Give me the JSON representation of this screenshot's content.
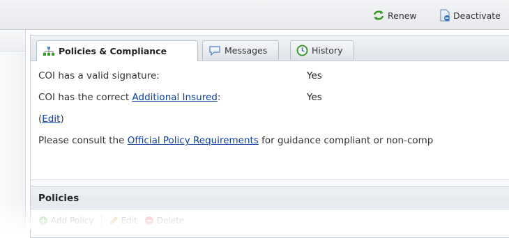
{
  "toolbar": {
    "renew_label": "Renew",
    "deactivate_label": "Deactivate"
  },
  "tabs": [
    {
      "label": "Policies & Compliance",
      "icon": "org-chart-icon",
      "active": true
    },
    {
      "label": "Messages",
      "icon": "speech-bubble-icon",
      "active": false
    },
    {
      "label": "History",
      "icon": "clock-icon",
      "active": false
    }
  ],
  "compliance": {
    "signature_label": "COI has a valid signature:",
    "signature_value": "Yes",
    "insured_prefix": "COI has the correct ",
    "insured_link": "Additional Insured",
    "insured_suffix": ":",
    "insured_value": "Yes",
    "edit_open": "(",
    "edit_link": "Edit",
    "edit_close": ")",
    "consult_prefix": "Please consult the ",
    "consult_link": "Official Policy Requirements",
    "consult_suffix": " for guidance compliant or non-comp"
  },
  "policies": {
    "title": "Policies",
    "add_label": "Add Policy",
    "edit_label": "Edit",
    "delete_label": "Delete"
  },
  "colors": {
    "link": "#0b3fa3",
    "renew_icon": "#3a9a2a",
    "deactivate_icon": "#2b6fc2"
  }
}
